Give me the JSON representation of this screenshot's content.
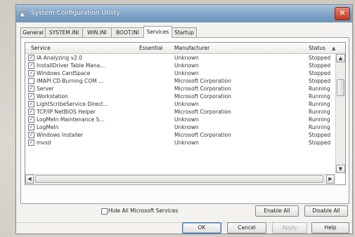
{
  "window": {
    "title": "System Configuration Utility",
    "close_glyph": "✕"
  },
  "tabs": [
    {
      "label": "General",
      "active": false
    },
    {
      "label": "SYSTEM.INI",
      "active": false
    },
    {
      "label": "WIN.INI",
      "active": false
    },
    {
      "label": "BOOT.INI",
      "active": false
    },
    {
      "label": "Services",
      "active": true
    },
    {
      "label": "Startup",
      "active": false
    }
  ],
  "services_list": {
    "columns": {
      "service": "Service",
      "essential": "Essential",
      "manufacturer": "Manufacturer",
      "status": "Status"
    },
    "sort_glyph": "▲",
    "rows": [
      {
        "service": "IA Analyzing v2.0",
        "essential": "",
        "manufacturer": "Unknown",
        "status": "Stopped",
        "checked": true
      },
      {
        "service": "InstallDriver Table Mana...",
        "essential": "",
        "manufacturer": "Unknown",
        "status": "Stopped",
        "checked": true
      },
      {
        "service": "Windows CardSpace",
        "essential": "",
        "manufacturer": "Unknown",
        "status": "Stopped",
        "checked": true
      },
      {
        "service": "IMAPI CD-Burning COM ...",
        "essential": "",
        "manufacturer": "Microsoft Corporation",
        "status": "Stopped",
        "checked": false
      },
      {
        "service": "Server",
        "essential": "",
        "manufacturer": "Microsoft Corporation",
        "status": "Running",
        "checked": true
      },
      {
        "service": "Workstation",
        "essential": "",
        "manufacturer": "Microsoft Corporation",
        "status": "Running",
        "checked": true
      },
      {
        "service": "LightScribeService Direct...",
        "essential": "",
        "manufacturer": "Unknown",
        "status": "Running",
        "checked": true
      },
      {
        "service": "TCP/IP NetBIOS Helper",
        "essential": "",
        "manufacturer": "Microsoft Corporation",
        "status": "Running",
        "checked": true
      },
      {
        "service": "LogMeIn Maintenance S...",
        "essential": "",
        "manufacturer": "Unknown",
        "status": "Running",
        "checked": true
      },
      {
        "service": "LogMeIn",
        "essential": "",
        "manufacturer": "Unknown",
        "status": "Running",
        "checked": true
      },
      {
        "service": "Windows Installer",
        "essential": "",
        "manufacturer": "Microsoft Corporation",
        "status": "Stopped",
        "checked": true
      },
      {
        "service": "mvsd",
        "essential": "",
        "manufacturer": "Unknown",
        "status": "Stopped",
        "checked": true
      }
    ],
    "scroll_up": "▲",
    "scroll_down": "▼",
    "scroll_left": "◀",
    "scroll_right": "▶"
  },
  "hide_ms_services": {
    "label": "Hide All Microsoft Services",
    "checked": false
  },
  "buttons": {
    "enable_all": "Enable All",
    "disable_all": "Disable All",
    "ok": "OK",
    "cancel": "Cancel",
    "apply": "Apply",
    "help": "Help"
  },
  "colors": {
    "titlebar": "#7fa2c6",
    "close_button": "#c33a22",
    "check_mark": "#1c3f78"
  }
}
